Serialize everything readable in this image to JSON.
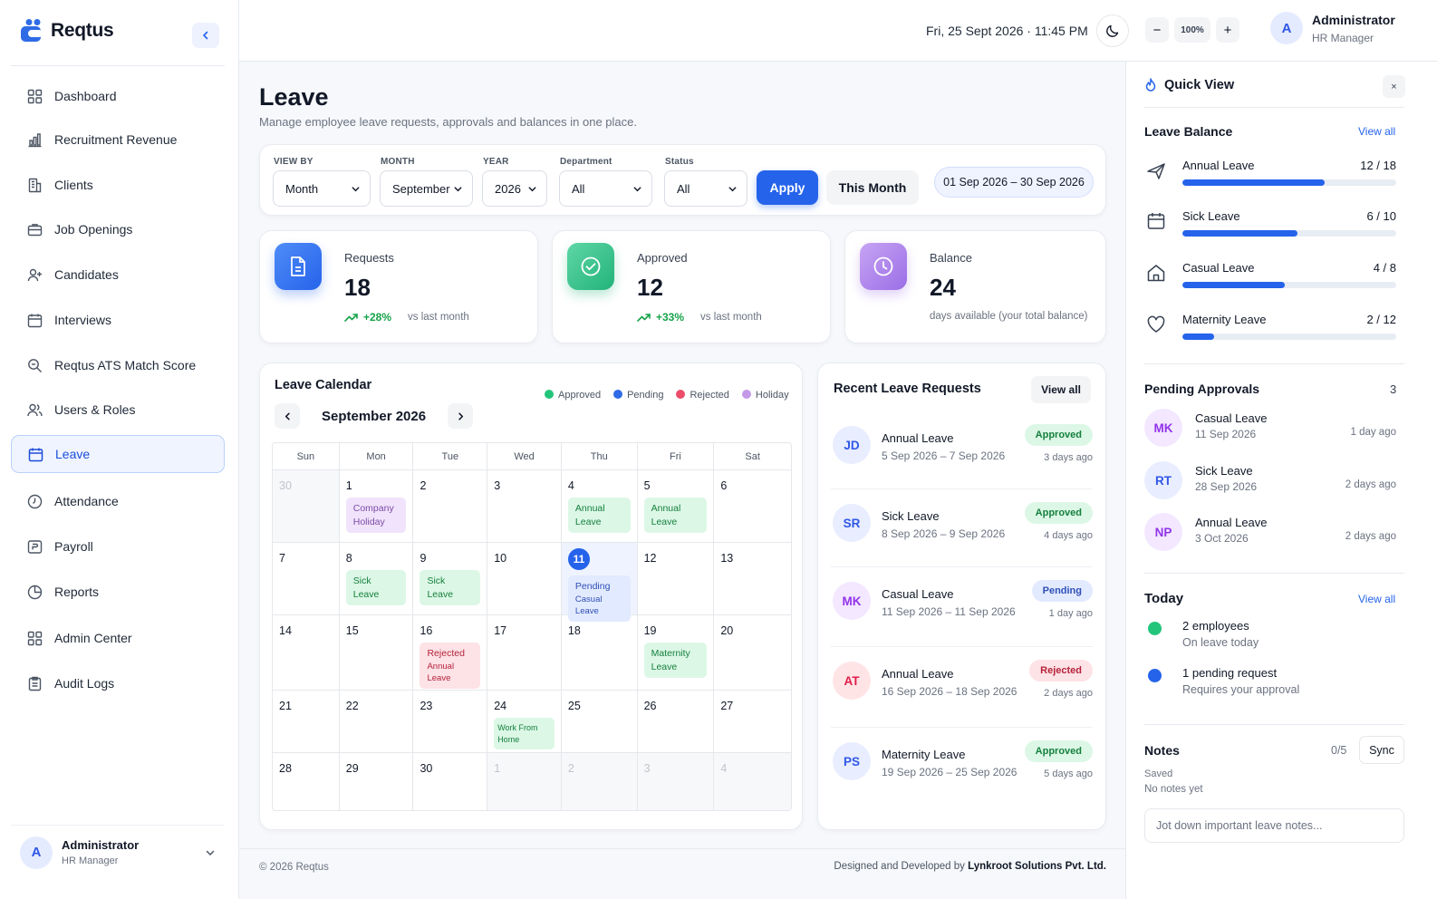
{
  "app": {
    "name": "Reqtus"
  },
  "sidebar": {
    "items": [
      {
        "label": "Dashboard"
      },
      {
        "label": "Recruitment Revenue"
      },
      {
        "label": "Clients"
      },
      {
        "label": "Job Openings"
      },
      {
        "label": "Candidates"
      },
      {
        "label": "Interviews"
      },
      {
        "label": "Reqtus ATS Match Score"
      },
      {
        "label": "Users & Roles"
      },
      {
        "label": "Leave",
        "active": true
      },
      {
        "label": "Attendance"
      },
      {
        "label": "Payroll"
      },
      {
        "label": "Reports"
      },
      {
        "label": "Admin Center"
      },
      {
        "label": "Audit Logs"
      }
    ],
    "user": {
      "initial": "A",
      "name": "Administrator",
      "role": "HR Manager"
    }
  },
  "topbar": {
    "datetime": "Fri, 25 Sept 2026 · 11:45 PM",
    "zoom": {
      "minus": "−",
      "value": "100%",
      "plus": "+"
    },
    "user": {
      "initial": "A",
      "name": "Administrator",
      "role": "HR Manager"
    }
  },
  "page": {
    "title": "Leave",
    "subtitle": "Manage employee leave requests, approvals and balances in one place."
  },
  "filters": {
    "view_by": {
      "label": "VIEW BY",
      "value": "Month"
    },
    "month": {
      "label": "MONTH",
      "value": "September"
    },
    "year": {
      "label": "YEAR",
      "value": "2026"
    },
    "department": {
      "label": "Department",
      "value": "All"
    },
    "status": {
      "label": "Status",
      "value": "All"
    },
    "apply_label": "Apply",
    "this_month_label": "This Month",
    "range": "01 Sep 2026 – 30 Sep 2026"
  },
  "stats": [
    {
      "label": "Requests",
      "value": "18",
      "trend": "+28%",
      "note": "vs last month"
    },
    {
      "label": "Approved",
      "value": "12",
      "trend": "+33%",
      "note": "vs last month"
    },
    {
      "label": "Balance",
      "value": "24",
      "note": "days available (your total balance)"
    }
  ],
  "calendar": {
    "title": "Leave Calendar",
    "month_label": "September 2026",
    "legend": [
      {
        "label": "Approved",
        "color": "#22c57a"
      },
      {
        "label": "Pending",
        "color": "#2f6be6"
      },
      {
        "label": "Rejected",
        "color": "#ec4d6b"
      },
      {
        "label": "Holiday",
        "color": "#c49be8"
      }
    ],
    "weekdays": [
      "Sun",
      "Mon",
      "Tue",
      "Wed",
      "Thu",
      "Fri",
      "Sat"
    ],
    "weeks": [
      [
        {
          "d": "30",
          "muted": true
        },
        {
          "d": "1",
          "event": {
            "text": "Company Holiday",
            "color": "purple"
          }
        },
        {
          "d": "2"
        },
        {
          "d": "3"
        },
        {
          "d": "4",
          "event": {
            "text": "Annual Leave",
            "color": "green"
          }
        },
        {
          "d": "5",
          "event": {
            "text": "Annual Leave",
            "color": "green"
          }
        },
        {
          "d": "6"
        }
      ],
      [
        {
          "d": "7"
        },
        {
          "d": "8",
          "event": {
            "text": "Sick Leave",
            "color": "green"
          }
        },
        {
          "d": "9",
          "event": {
            "text": "Sick Leave",
            "color": "green"
          }
        },
        {
          "d": "10"
        },
        {
          "d": "11",
          "today": true,
          "event": {
            "text": "Pending",
            "sub": "Casual Leave",
            "color": "blue"
          }
        },
        {
          "d": "12"
        },
        {
          "d": "13"
        }
      ],
      [
        {
          "d": "14"
        },
        {
          "d": "15"
        },
        {
          "d": "16",
          "event": {
            "text": "Rejected",
            "sub": "Annual Leave",
            "color": "red"
          }
        },
        {
          "d": "17"
        },
        {
          "d": "18"
        },
        {
          "d": "19",
          "event": {
            "text": "Maternity Leave",
            "color": "green"
          }
        },
        {
          "d": "20"
        }
      ],
      [
        {
          "d": "21"
        },
        {
          "d": "22"
        },
        {
          "d": "23"
        },
        {
          "d": "24",
          "event": {
            "text": "Work From Home",
            "color": "green",
            "small": true
          }
        },
        {
          "d": "25"
        },
        {
          "d": "26"
        },
        {
          "d": "27"
        }
      ],
      [
        {
          "d": "28"
        },
        {
          "d": "29"
        },
        {
          "d": "30"
        },
        {
          "d": "1",
          "muted": true
        },
        {
          "d": "2",
          "muted": true
        },
        {
          "d": "3",
          "muted": true
        },
        {
          "d": "4",
          "muted": true
        }
      ]
    ]
  },
  "recent": {
    "title": "Recent Leave Requests",
    "view_all_label": "View all",
    "items": [
      {
        "initials": "JD",
        "type": "Annual Leave",
        "dates": "5 Sep 2026 – 7 Sep 2026",
        "status": "Approved",
        "ago": "3 days ago",
        "bg": "#e8edff",
        "fg": "#2f58e6"
      },
      {
        "initials": "SR",
        "type": "Sick Leave",
        "dates": "8 Sep 2026 – 9 Sep 2026",
        "status": "Approved",
        "ago": "4 days ago",
        "bg": "#e8edff",
        "fg": "#2f58e6"
      },
      {
        "initials": "MK",
        "type": "Casual Leave",
        "dates": "11 Sep 2026 – 11 Sep 2026",
        "status": "Pending",
        "ago": "1 day ago",
        "bg": "#f3e8ff",
        "fg": "#9333ea"
      },
      {
        "initials": "AT",
        "type": "Annual Leave",
        "dates": "16 Sep 2026 – 18 Sep 2026",
        "status": "Rejected",
        "ago": "2 days ago",
        "bg": "#ffe4e6",
        "fg": "#e11d48"
      },
      {
        "initials": "PS",
        "type": "Maternity Leave",
        "dates": "19 Sep 2026 – 25 Sep 2026",
        "status": "Approved",
        "ago": "5 days ago",
        "bg": "#e8edff",
        "fg": "#2f58e6"
      }
    ]
  },
  "footer": {
    "copyright": "© 2026 Reqtus",
    "credit_prefix": "Designed and Developed by",
    "credit_company": "Lynkroot Solutions Pvt. Ltd."
  },
  "quick_view": {
    "title": "Quick View",
    "close": "×",
    "leave_balance": {
      "title": "Leave Balance",
      "view_all_label": "View all",
      "items": [
        {
          "name": "Annual Leave",
          "value": "12 / 18",
          "fraction": 0.6667,
          "icon": "plane-icon"
        },
        {
          "name": "Sick Leave",
          "value": "6 / 10",
          "fraction": 0.54,
          "icon": "calendar-icon"
        },
        {
          "name": "Casual Leave",
          "value": "4 / 8",
          "fraction": 0.48,
          "icon": "home-icon"
        },
        {
          "name": "Maternity Leave",
          "value": "2 / 12",
          "fraction": 0.15,
          "icon": "heart-icon"
        }
      ]
    },
    "pending": {
      "title": "Pending Approvals",
      "count": "3",
      "items": [
        {
          "initials": "MK",
          "type": "Casual Leave",
          "date": "11 Sep 2026",
          "ago": "1 day ago",
          "bg": "#f3e8ff",
          "fg": "#9333ea"
        },
        {
          "initials": "RT",
          "type": "Sick Leave",
          "date": "28 Sep 2026",
          "ago": "2 days ago",
          "bg": "#e8edff",
          "fg": "#2f58e6"
        },
        {
          "initials": "NP",
          "type": "Annual Leave",
          "date": "3 Oct 2026",
          "ago": "2 days ago",
          "bg": "#f3e8ff",
          "fg": "#9333ea"
        }
      ]
    },
    "today": {
      "title": "Today",
      "view_all_label": "View all",
      "items": [
        {
          "main": "2 employees",
          "sub": "On leave today",
          "color": "#22c57a"
        },
        {
          "main": "1 pending request",
          "sub": "Requires your approval",
          "color": "#2563eb"
        }
      ]
    },
    "notes": {
      "title": "Notes",
      "count": "0/5",
      "sync_label": "Sync",
      "saved": "Saved",
      "empty": "No notes yet",
      "placeholder": "Jot down important leave notes..."
    }
  }
}
